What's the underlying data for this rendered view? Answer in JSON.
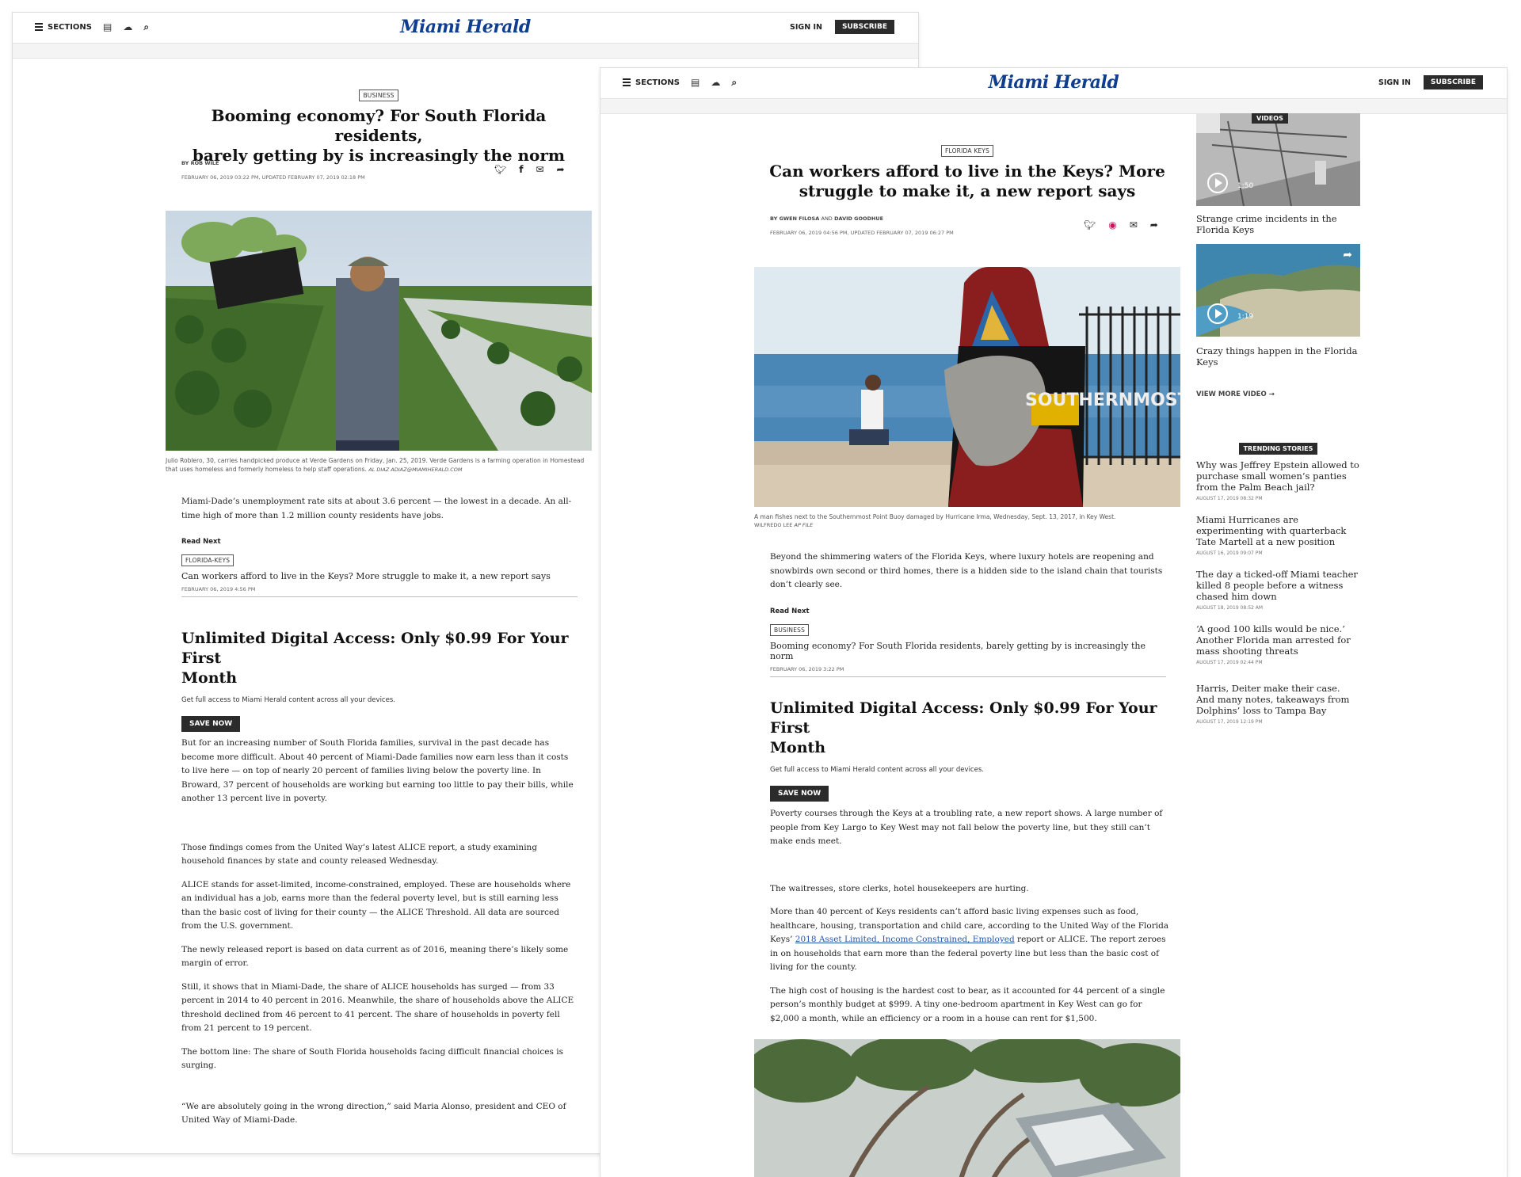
{
  "colors": {
    "logo": "#0f3e8f",
    "button_bg": "#2b2b2b",
    "link": "#2255aa"
  },
  "header": {
    "sections_label": "SECTIONS",
    "logo_text": "Miami Herald",
    "sign_in": "SIGN IN",
    "subscribe": "SUBSCRIBE",
    "icons": [
      "hamburger-icon",
      "e-edition-icon",
      "weather-icon",
      "search-icon"
    ]
  },
  "article1": {
    "section_tag": "BUSINESS",
    "headline_line1": "Booming economy? For South Florida residents,",
    "headline_line2": "barely getting by is increasingly the norm",
    "byline": "BY ROB WILE",
    "date": "FEBRUARY 06, 2019 03:22 PM, UPDATED FEBRUARY 07, 2019 02:18 PM",
    "caption": "Julio Roblero, 30, carries handpicked produce at Verde Gardens on Friday, Jan. 25, 2019. Verde Gardens is a farming operation in Homestead that uses homeless and formerly homeless to help staff operations.",
    "credit": "AL DIAZ ADIAZ@MIAMIHERALD.COM",
    "intro": "Miami-Dade’s unemployment rate sits at about 3.6 percent — the lowest in a decade. An all-time high of more than 1.2 million county residents have jobs.",
    "read_next": {
      "label": "Read Next",
      "tag": "FLORIDA-KEYS",
      "title": "Can workers afford to live in the Keys? More struggle to make it, a new report says",
      "date": "FEBRUARY 06, 2019 4:56 PM"
    },
    "promo": {
      "title_line1": "Unlimited Digital Access: Only $0.99 For Your First",
      "title_line2": "Month",
      "sub": "Get full access to Miami Herald content across all your devices.",
      "button": "SAVE NOW"
    },
    "paragraphs": [
      "But for an increasing number of South Florida families, survival in the past decade has become more difficult. About 40 percent of Miami-Dade families now earn less than it costs to live here — on top of nearly 20 percent of families living below the poverty line. In Broward, 37 percent of households are working but earning too little to pay their bills, while another 13 percent live in poverty.",
      "Those findings comes from the United Way’s latest ALICE report, a study examining household finances by state and county released Wednesday.",
      "ALICE stands for asset-limited, income-constrained, employed. These are households where an individual has a job, earns more than the federal poverty level, but is still earning less than the basic cost of living for their county — the ALICE Threshold. All data are sourced from the U.S. government.",
      "The newly released report is based on data current as of 2016, meaning there’s likely some margin of error.",
      "Still, it shows that in Miami-Dade, the share of ALICE households has surged — from 33 percent in 2014 to 40 percent in 2016. Meanwhile, the share of households above the ALICE threshold declined from 46 percent to 41 percent. The share of households in poverty fell from 21 percent to 19 percent.",
      "The bottom line: The share of South Florida households facing difficult financial choices is surging.",
      "“We are absolutely going in the wrong direction,” said Maria Alonso, president and CEO of United Way of Miami-Dade."
    ]
  },
  "article2": {
    "section_tag": "FLORIDA KEYS",
    "headline_line1": "Can workers afford to live in the Keys? More",
    "headline_line2": "struggle to make it, a new report says",
    "byline_prefix": "BY GWEN FILOSA",
    "byline_and": "AND",
    "byline_second": "DAVID GOODHUE",
    "date": "FEBRUARY 06, 2019 04:56 PM, UPDATED FEBRUARY 07, 2019 06:27 PM",
    "photo_text": "SOUTHERNMOST",
    "caption": "A man fishes next to the Southernmost Point Buoy damaged by Hurricane Irma, Wednesday, Sept. 13, 2017, in Key West.",
    "credit_name": "WILFREDO LEE",
    "credit_org": "AP FILE",
    "intro": "Beyond the shimmering waters of the Florida Keys, where luxury hotels are reopening and snowbirds own second or third homes, there is a hidden side to the island chain that tourists don’t clearly see.",
    "read_next": {
      "label": "Read Next",
      "tag": "BUSINESS",
      "title": "Booming economy? For South Florida residents, barely getting by is increasingly the norm",
      "date": "FEBRUARY 06, 2019 3:22 PM"
    },
    "promo": {
      "title_line1": "Unlimited Digital Access: Only $0.99 For Your First",
      "title_line2": "Month",
      "sub": "Get full access to Miami Herald content across all your devices.",
      "button": "SAVE NOW"
    },
    "p1": "Poverty courses through the Keys at a troubling rate, a new report shows. A large number of people from Key Largo to Key West may not fall below the poverty line, but they still can’t make ends meet.",
    "p2": "The waitresses, store clerks, hotel housekeepers are hurting.",
    "p3_before": "More than 40 percent of Keys residents can’t afford basic living expenses such as food, healthcare, housing, transportation and child care, according to the United Way of the Florida Keys’",
    "p3_link": "2018 Asset Limited, Income Constrained, Employed",
    "p3_after": "report or ALICE. The report zeroes in on households that earn more than the federal poverty line but less than the basic cost of living for the county.",
    "p4": "The high cost of housing is the hardest cost to bear, as it accounted for 44 percent of a single person’s monthly budget at $999. A tiny one-bedroom apartment in Key West can go for $2,000 a month, while an efficiency or a room in a house can rent for $1,500."
  },
  "sidebar": {
    "videos_label": "VIDEOS",
    "videos": [
      {
        "duration": "1:50",
        "title": "Strange crime incidents in the Florida Keys"
      },
      {
        "duration": "1:19",
        "title": "Crazy things happen in the Florida Keys"
      }
    ],
    "view_more": "VIEW MORE VIDEO",
    "trending_label": "TRENDING STORIES",
    "trending": [
      {
        "title": "Why was Jeffrey Epstein allowed to purchase small women’s panties from the Palm Beach jail?",
        "date": "AUGUST 17, 2019 08:32 PM"
      },
      {
        "title": "Miami Hurricanes are experimenting with quarterback Tate Martell at a new position",
        "date": "AUGUST 16, 2019 09:07 PM"
      },
      {
        "title": "The day a ticked-off Miami teacher killed 8 people before a witness chased him down",
        "date": "AUGUST 18, 2019 08:52 AM"
      },
      {
        "title": "‘A good 100 kills would be nice.’ Another Florida man arrested for mass shooting threats",
        "date": "AUGUST 17, 2019 02:44 PM"
      },
      {
        "title": "Harris, Deiter make their case. And many notes, takeaways from Dolphins’ loss to Tampa Bay",
        "date": "AUGUST 17, 2019 12:19 PM"
      }
    ]
  }
}
